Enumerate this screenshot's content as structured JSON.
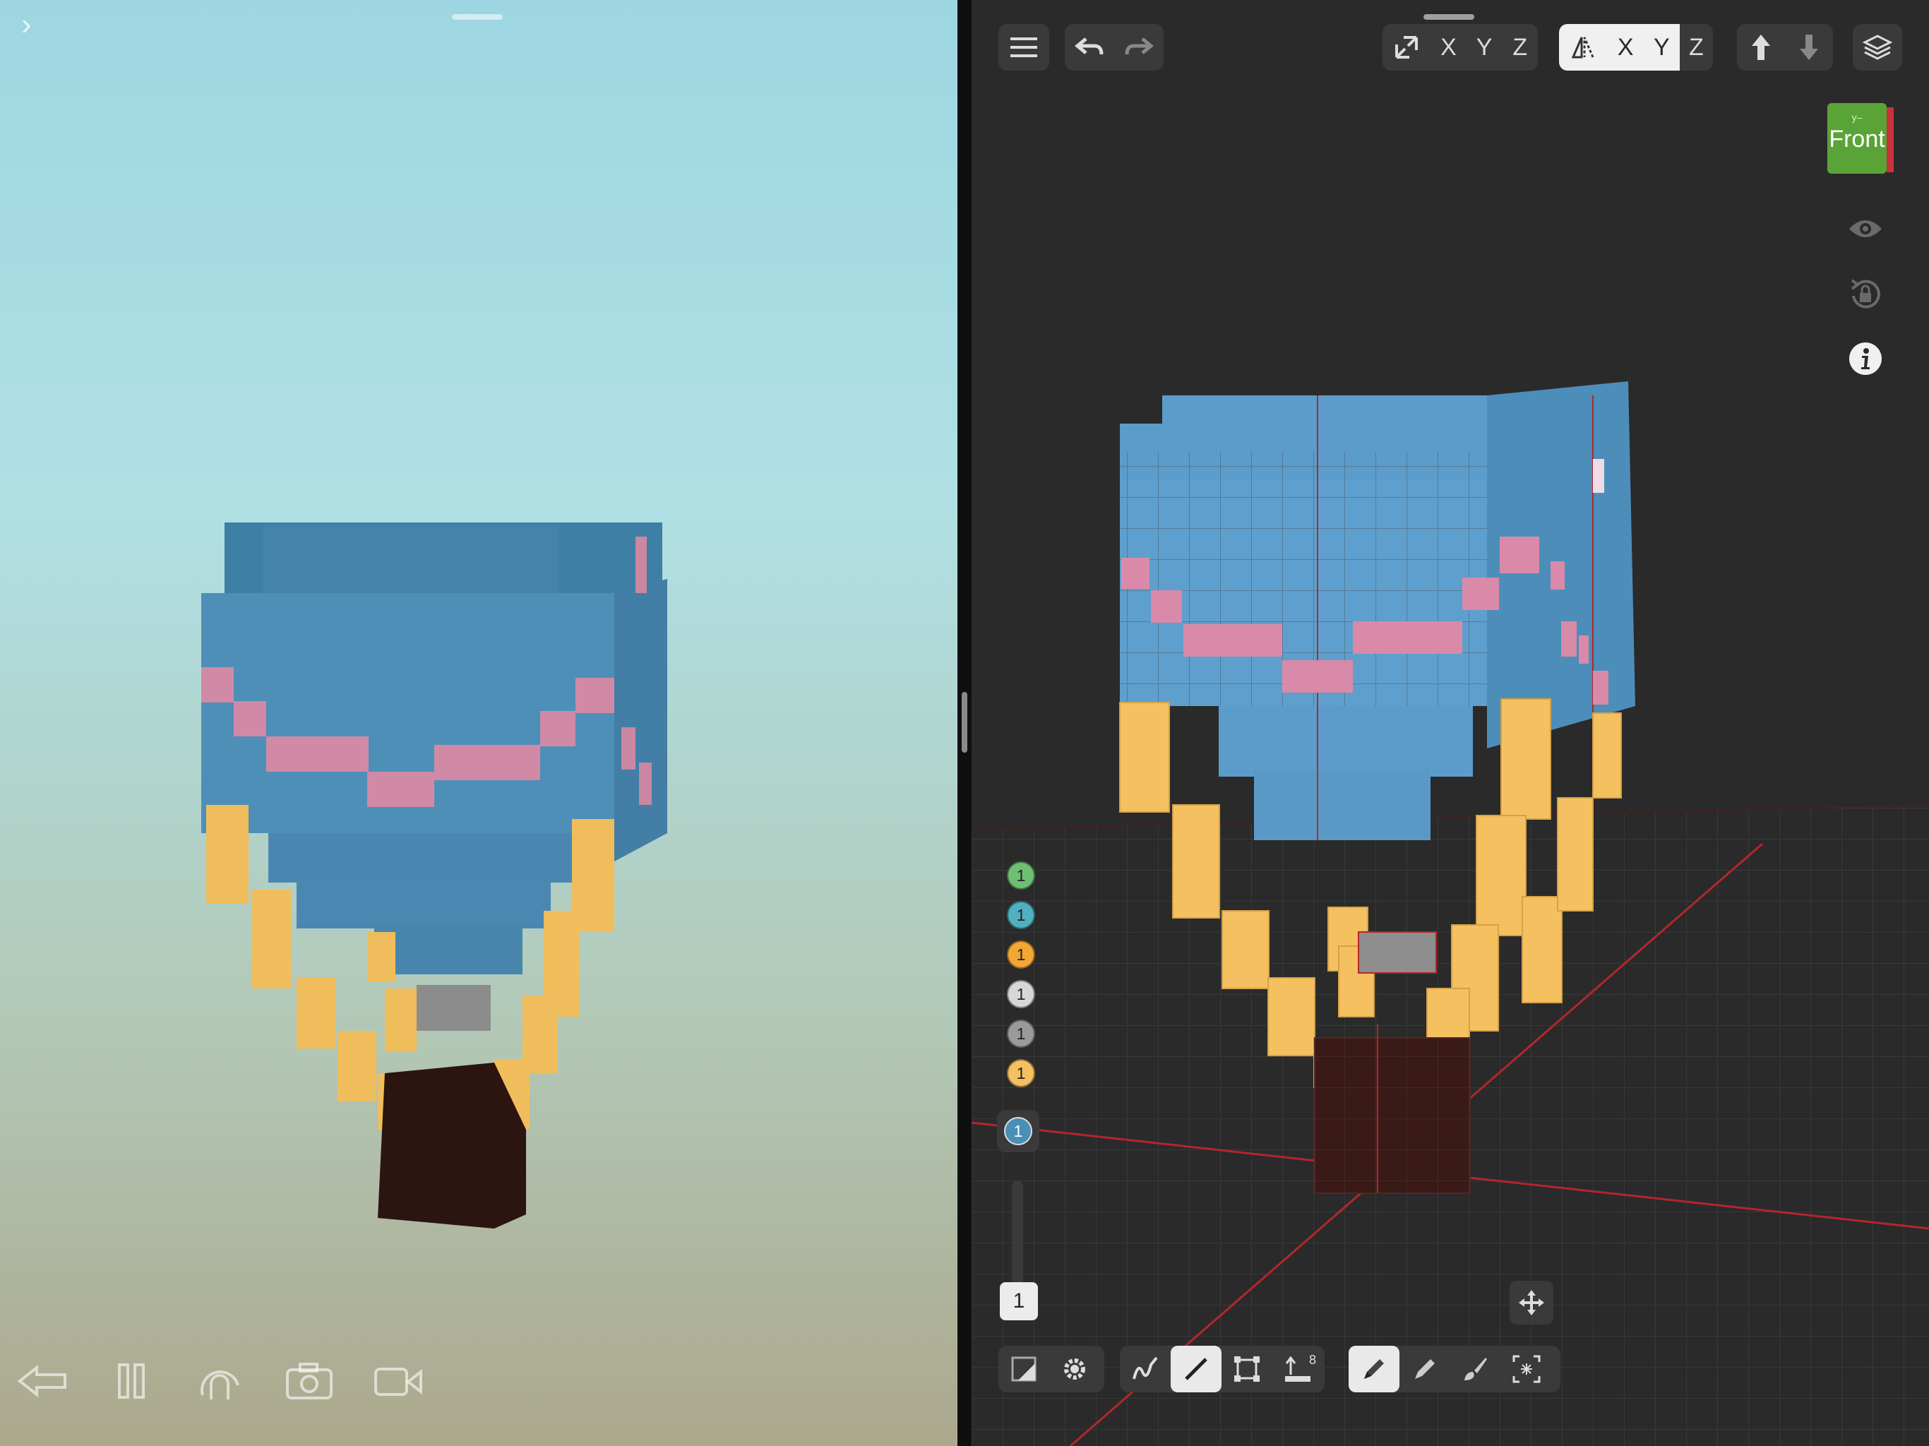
{
  "viewer": {
    "controls": [
      {
        "name": "back-arrow-icon"
      },
      {
        "name": "pause-icon"
      },
      {
        "name": "rotate-icon"
      },
      {
        "name": "camera-icon"
      },
      {
        "name": "video-icon"
      }
    ],
    "expand_glyph": "›"
  },
  "toolbar": {
    "axes_mirror": [
      "X",
      "Y",
      "Z"
    ],
    "axes_symmetry": [
      "X",
      "Y",
      "Z"
    ],
    "symmetry_selected_axis": "Y"
  },
  "view_cube": {
    "label": "Front",
    "small_label": "y–"
  },
  "palette": {
    "counts": [
      "1",
      "1",
      "1",
      "1",
      "1",
      "1"
    ],
    "colors": [
      "#6fbf73",
      "#4fb0c0",
      "#f2a634",
      "#d7d7d7",
      "#9a9a9a",
      "#f5c060"
    ],
    "selected_count": "1",
    "selected_color": "#4a8fb5"
  },
  "brush_size": {
    "value": "1"
  },
  "tool_badges": {
    "extrude_label": "8"
  },
  "colors": {
    "voxel_blue": "#4e8fb8",
    "voxel_pink": "#d98aa8",
    "voxel_yellow": "#f3c15f",
    "voxel_dark": "#2f1512",
    "voxel_gray": "#8c8c8c",
    "editor_bg": "#2a2a2a",
    "grid_red": "#b3262c"
  }
}
